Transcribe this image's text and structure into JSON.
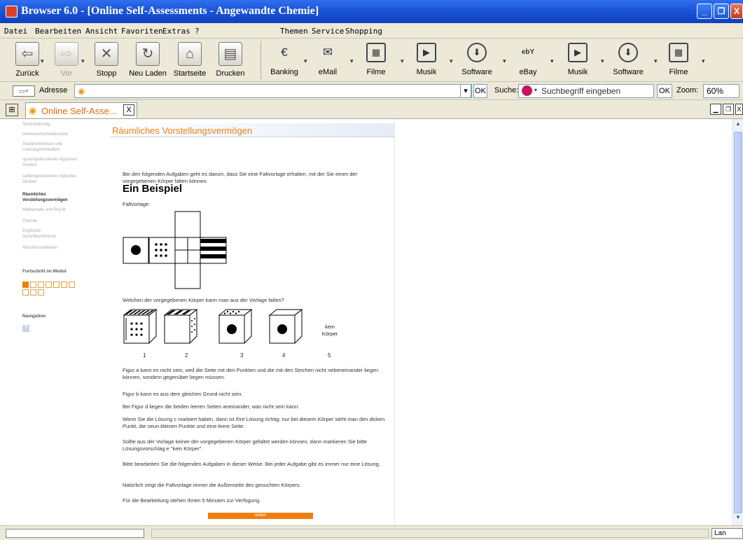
{
  "window": {
    "title": "Browser 6.0 - [Online Self-Assessments - Angewandte Chemie]",
    "minimize": "_",
    "restore": "❐",
    "close": "X"
  },
  "menu": {
    "items": [
      "Datei",
      "Bearbeiten",
      "Ansicht",
      "Favoriten",
      "Extras",
      "?"
    ],
    "right_items": [
      "Themen",
      "Service",
      "Shopping"
    ]
  },
  "toolbar": {
    "buttons": [
      {
        "label": "Zurück",
        "icon": "arrow-left-icon"
      },
      {
        "label": "Vor",
        "icon": "arrow-right-icon"
      },
      {
        "label": "Stopp",
        "icon": "stop-icon"
      },
      {
        "label": "Neu Laden",
        "icon": "refresh-icon"
      },
      {
        "label": "Startseite",
        "icon": "home-icon"
      },
      {
        "label": "Drucken",
        "icon": "printer-icon"
      }
    ],
    "links": [
      {
        "label": "Banking",
        "icon": "euro-icon"
      },
      {
        "label": "eMail",
        "icon": "envelope-icon"
      },
      {
        "label": "Filme",
        "icon": "film-icon"
      },
      {
        "label": "Musik",
        "icon": "play-icon"
      },
      {
        "label": "Software",
        "icon": "download-icon"
      },
      {
        "label": "eBay",
        "icon": "ebay-icon"
      },
      {
        "label": "Musik",
        "icon": "play-icon"
      },
      {
        "label": "Software",
        "icon": "download-icon"
      },
      {
        "label": "Filme",
        "icon": "film-icon"
      }
    ]
  },
  "address": {
    "label": "Adresse",
    "ok": "OK",
    "search_label": "Suche:",
    "search_placeholder": "Suchbegriff eingeben",
    "zoom_label": "Zoom:",
    "zoom_value": "60%"
  },
  "tab": {
    "label": "Online Self-Asse...",
    "close": "X"
  },
  "sidebar": {
    "items": [
      "Testeinführung",
      "Interessenschwerpunkte",
      "Studieninteresse und Leistungsmotivation",
      "sprachgebundenes logisches Denken",
      "zahlengebundenes logisches Denken",
      "Räumliches Vorstellungsvermögen",
      "Mathematik und Physik",
      "Chemie",
      "Englische Sprachkenntnisse",
      "Abschlussreflexion"
    ],
    "active_index": 5,
    "progress_title": "Fortschritt im Modul",
    "progress_done": 1,
    "progress_total": 10,
    "navigation_title": "Navigation",
    "help": "?"
  },
  "page": {
    "heading": "Räumliches Vorstellungsvermögen",
    "intro": "Bei den folgenden Aufgaben geht es darum, dass Sie eine Faltvorlage erhalten, mit der Sie einen der vorgegebenen Körper falten können.",
    "example_title": "Ein Beispiel",
    "faltvorlage_label": "Faltvorlage:",
    "question": "Welchen der vorgegebenen Körper kann man aus der Vorlage falten?",
    "options": [
      "1",
      "2",
      "3",
      "4",
      "5"
    ],
    "no_body_label": "kein Körper",
    "paragraphs": [
      "Figur a kann es nicht sein, weil die Seite mit den Punkten und die mit den Strichen nicht nebeneinander liegen können, sondern gegenüber liegen müssen.",
      "Figur b kann es aus dem gleichen Grund nicht sein.",
      "Bei Figur d liegen die beiden leeren Seiten aneinander, was nicht sein kann.",
      "Wenn Sie die Lösung c markiert haben, dann ist Ihre Lösung richtig; nur bei diesem Körper sieht man den dicken Punkt, die neun kleinen Punkte und eine leere Seite.",
      "Sollte aus der Vorlage keiner der vorgegebenen Körper gefaltet werden können, dann markieren Sie bitte Lösungsvorschlag e \"kein Körper\".",
      "Bitte bearbeiten Sie die folgenden Aufgaben in dieser Weise. Bei jeder Aufgabe gibt es immer nur eine Lösung.",
      "Natürlich zeigt die Faltvorlage immer die Außenseite des gesuchten Körpers.",
      "Für die Bearbeitung stehen Ihnen 5 Minuten zur Verfügung."
    ],
    "weiter": "weiter"
  },
  "status": {
    "connection": "Lan"
  }
}
